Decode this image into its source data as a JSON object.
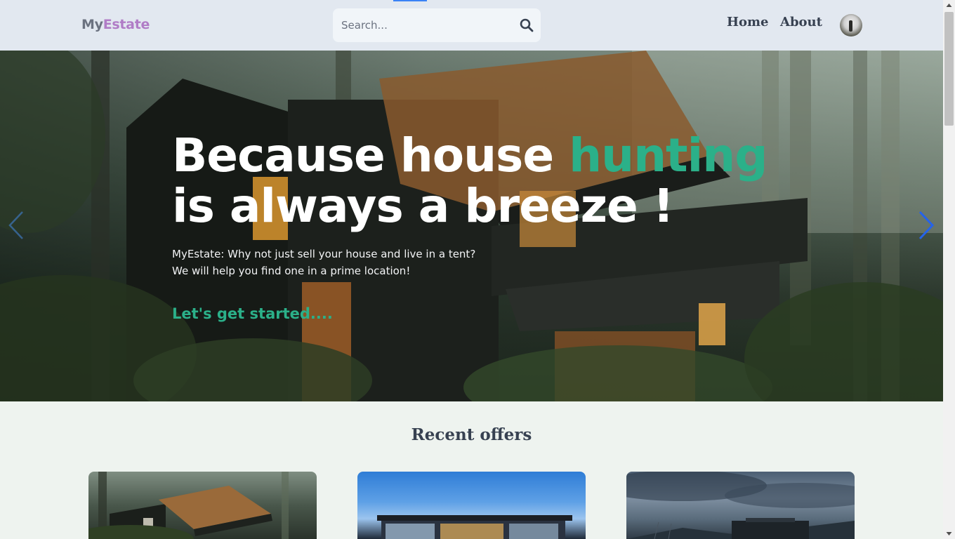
{
  "header": {
    "logo_prefix": "My",
    "logo_suffix": "Estate",
    "search_placeholder": "Search...",
    "nav": [
      "Home",
      "About"
    ]
  },
  "hero": {
    "title_part1": "Because house ",
    "title_accent": "hunting",
    "title_part2": " is always a breeze !",
    "subtitle_line1": "MyEstate: Why not just sell your house and live in a tent?",
    "subtitle_line2": "We will help you find one in a prime location!",
    "cta": "Let's get started...."
  },
  "offers": {
    "title": "Recent offers"
  },
  "colors": {
    "accent": "#2bb089",
    "logo_accent": "#b07cc6",
    "header_bg": "#e2e8f0",
    "page_bg": "#eef3ef",
    "text_dark": "#374151"
  },
  "icons": [
    "search-icon",
    "chevron-left-icon",
    "chevron-right-icon",
    "avatar"
  ]
}
